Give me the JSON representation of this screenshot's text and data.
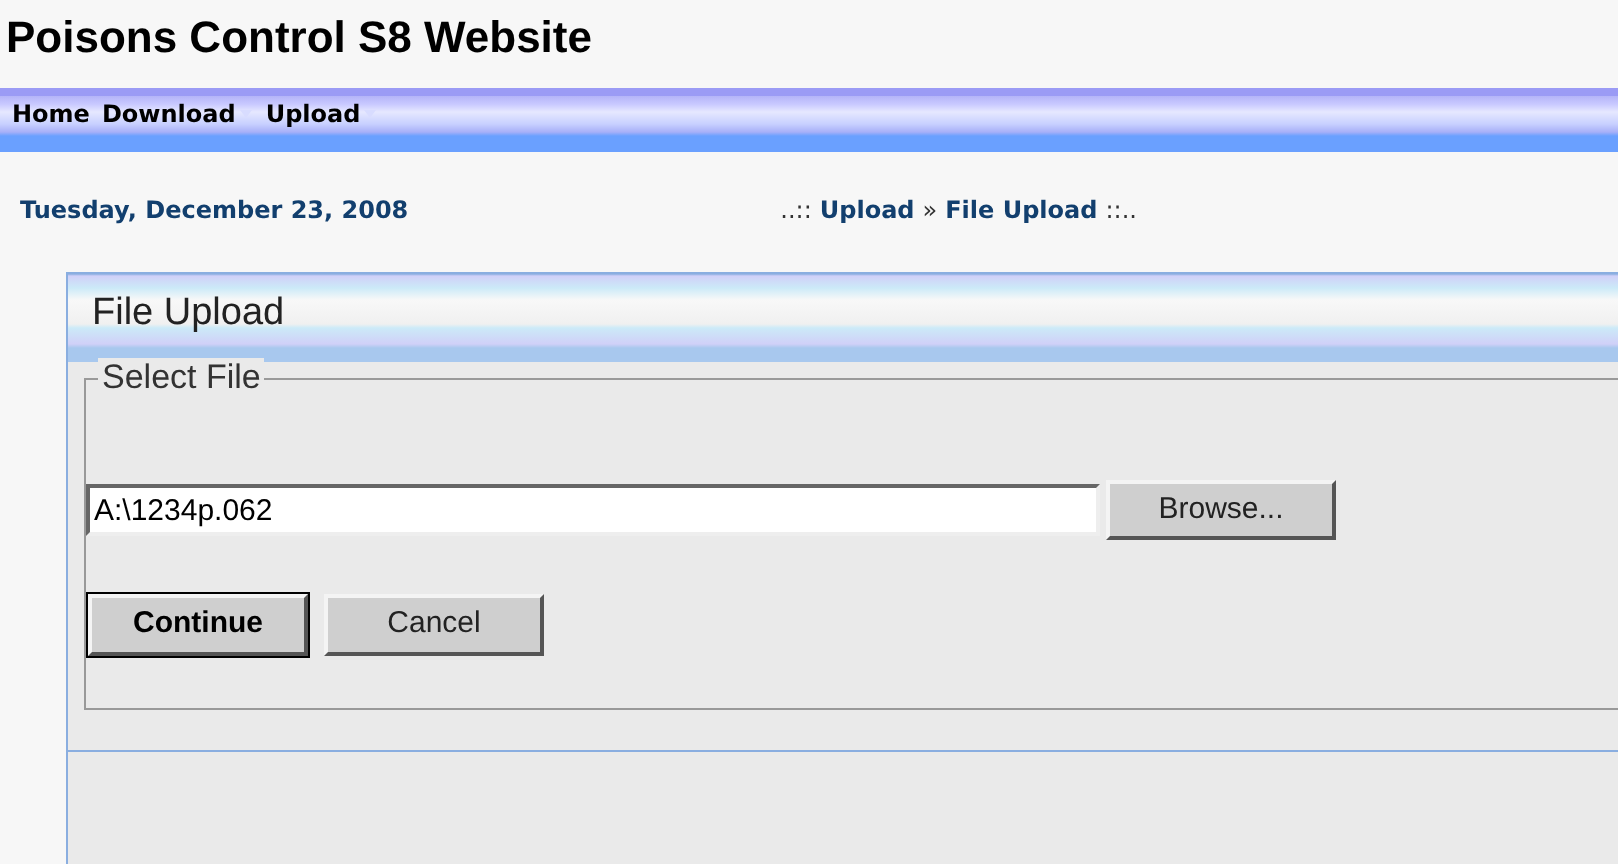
{
  "site_title": "Poisons Control S8 Website",
  "menu": [
    {
      "label": "Home",
      "has_submenu": false
    },
    {
      "label": "Download",
      "has_submenu": true
    },
    {
      "label": "Upload",
      "has_submenu": true
    }
  ],
  "date": "Tuesday, December 23, 2008",
  "breadcrumb": {
    "prefix": "..::",
    "items": [
      "Upload",
      "File Upload"
    ],
    "separator": "»",
    "suffix": "::.."
  },
  "panel": {
    "title": "File Upload",
    "fieldset_legend": "Select File",
    "file_value": "A:\\1234p.062",
    "browse_label": "Browse...",
    "buttons": [
      {
        "label": "Continue",
        "default": true
      },
      {
        "label": "Cancel",
        "default": false
      }
    ]
  }
}
